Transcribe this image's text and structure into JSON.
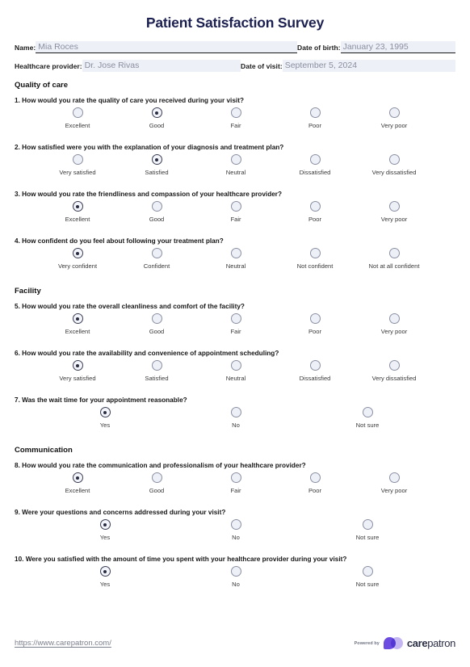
{
  "title": "Patient Satisfaction Survey",
  "header": {
    "name_label": "Name:",
    "name_value": "Mia Roces",
    "dob_label": "Date of birth:",
    "dob_value": "January 23, 1995",
    "provider_label": "Healthcare provider:",
    "provider_value": "Dr. Jose Rivas",
    "visit_label": "Date of visit:",
    "visit_value": "September 5, 2024"
  },
  "sections": [
    {
      "title": "Quality of care",
      "questions": [
        {
          "text": "1. How would you rate the quality of care you received during your visit?",
          "options": [
            "Excellent",
            "Good",
            "Fair",
            "Poor",
            "Very poor"
          ],
          "selected": 1
        },
        {
          "text": "2. How satisfied were you with the explanation of your diagnosis and treatment plan?",
          "options": [
            "Very satisfied",
            "Satisfied",
            "Neutral",
            "Dissatisfied",
            "Very dissatisfied"
          ],
          "selected": 1
        },
        {
          "text": "3. How would you rate the friendliness and compassion of your healthcare provider?",
          "options": [
            "Excellent",
            "Good",
            "Fair",
            "Poor",
            "Very poor"
          ],
          "selected": 0
        },
        {
          "text": "4. How confident do you feel about following your treatment plan?",
          "options": [
            "Very confident",
            "Confident",
            "Neutral",
            "Not confident",
            "Not at all confident"
          ],
          "selected": 0
        }
      ]
    },
    {
      "title": "Facility",
      "questions": [
        {
          "text": "5. How would you rate the overall cleanliness and comfort of the facility?",
          "options": [
            "Excellent",
            "Good",
            "Fair",
            "Poor",
            "Very poor"
          ],
          "selected": 0
        },
        {
          "text": "6. How would you rate the availability and convenience of appointment scheduling?",
          "options": [
            "Very satisfied",
            "Satisfied",
            "Neutral",
            "Dissatisfied",
            "Very dissatisfied"
          ],
          "selected": 0
        },
        {
          "text": "7. Was the wait time for your appointment reasonable?",
          "options": [
            "Yes",
            "No",
            "Not sure"
          ],
          "selected": 0
        }
      ]
    },
    {
      "title": "Communication",
      "questions": [
        {
          "text": "8. How would you rate the communication and professionalism of your healthcare provider?",
          "options": [
            "Excellent",
            "Good",
            "Fair",
            "Poor",
            "Very poor"
          ],
          "selected": 0
        },
        {
          "text": "9. Were your questions and concerns addressed during your visit?",
          "options": [
            "Yes",
            "No",
            "Not sure"
          ],
          "selected": 0
        },
        {
          "text": "10. Were you satisfied with the amount of time you spent with your healthcare provider during your visit?",
          "options": [
            "Yes",
            "No",
            "Not sure"
          ],
          "selected": 0
        }
      ]
    }
  ],
  "footer": {
    "link": "https://www.carepatron.com/",
    "powered_by": "Powered by",
    "brand_bold": "care",
    "brand_light": "patron"
  },
  "colors": {
    "title": "#1c2050",
    "field_bg": "#eef0f8",
    "field_text": "#8a8f9e",
    "radio_border": "#8b90a3",
    "radio_checked_dot": "#2a2d40",
    "brand_primary": "#6c4ce0",
    "brand_secondary": "#c3b6f2"
  }
}
